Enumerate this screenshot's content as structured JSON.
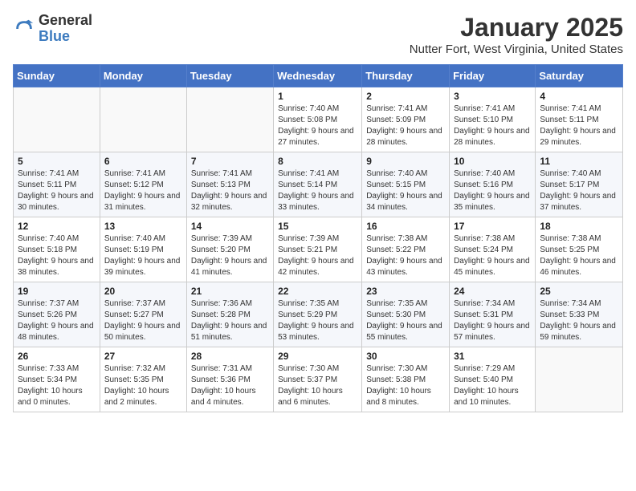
{
  "logo": {
    "general": "General",
    "blue": "Blue"
  },
  "title": "January 2025",
  "subtitle": "Nutter Fort, West Virginia, United States",
  "weekdays": [
    "Sunday",
    "Monday",
    "Tuesday",
    "Wednesday",
    "Thursday",
    "Friday",
    "Saturday"
  ],
  "weeks": [
    [
      {
        "day": "",
        "text": ""
      },
      {
        "day": "",
        "text": ""
      },
      {
        "day": "",
        "text": ""
      },
      {
        "day": "1",
        "text": "Sunrise: 7:40 AM\nSunset: 5:08 PM\nDaylight: 9 hours and 27 minutes."
      },
      {
        "day": "2",
        "text": "Sunrise: 7:41 AM\nSunset: 5:09 PM\nDaylight: 9 hours and 28 minutes."
      },
      {
        "day": "3",
        "text": "Sunrise: 7:41 AM\nSunset: 5:10 PM\nDaylight: 9 hours and 28 minutes."
      },
      {
        "day": "4",
        "text": "Sunrise: 7:41 AM\nSunset: 5:11 PM\nDaylight: 9 hours and 29 minutes."
      }
    ],
    [
      {
        "day": "5",
        "text": "Sunrise: 7:41 AM\nSunset: 5:11 PM\nDaylight: 9 hours and 30 minutes."
      },
      {
        "day": "6",
        "text": "Sunrise: 7:41 AM\nSunset: 5:12 PM\nDaylight: 9 hours and 31 minutes."
      },
      {
        "day": "7",
        "text": "Sunrise: 7:41 AM\nSunset: 5:13 PM\nDaylight: 9 hours and 32 minutes."
      },
      {
        "day": "8",
        "text": "Sunrise: 7:41 AM\nSunset: 5:14 PM\nDaylight: 9 hours and 33 minutes."
      },
      {
        "day": "9",
        "text": "Sunrise: 7:40 AM\nSunset: 5:15 PM\nDaylight: 9 hours and 34 minutes."
      },
      {
        "day": "10",
        "text": "Sunrise: 7:40 AM\nSunset: 5:16 PM\nDaylight: 9 hours and 35 minutes."
      },
      {
        "day": "11",
        "text": "Sunrise: 7:40 AM\nSunset: 5:17 PM\nDaylight: 9 hours and 37 minutes."
      }
    ],
    [
      {
        "day": "12",
        "text": "Sunrise: 7:40 AM\nSunset: 5:18 PM\nDaylight: 9 hours and 38 minutes."
      },
      {
        "day": "13",
        "text": "Sunrise: 7:40 AM\nSunset: 5:19 PM\nDaylight: 9 hours and 39 minutes."
      },
      {
        "day": "14",
        "text": "Sunrise: 7:39 AM\nSunset: 5:20 PM\nDaylight: 9 hours and 41 minutes."
      },
      {
        "day": "15",
        "text": "Sunrise: 7:39 AM\nSunset: 5:21 PM\nDaylight: 9 hours and 42 minutes."
      },
      {
        "day": "16",
        "text": "Sunrise: 7:38 AM\nSunset: 5:22 PM\nDaylight: 9 hours and 43 minutes."
      },
      {
        "day": "17",
        "text": "Sunrise: 7:38 AM\nSunset: 5:24 PM\nDaylight: 9 hours and 45 minutes."
      },
      {
        "day": "18",
        "text": "Sunrise: 7:38 AM\nSunset: 5:25 PM\nDaylight: 9 hours and 46 minutes."
      }
    ],
    [
      {
        "day": "19",
        "text": "Sunrise: 7:37 AM\nSunset: 5:26 PM\nDaylight: 9 hours and 48 minutes."
      },
      {
        "day": "20",
        "text": "Sunrise: 7:37 AM\nSunset: 5:27 PM\nDaylight: 9 hours and 50 minutes."
      },
      {
        "day": "21",
        "text": "Sunrise: 7:36 AM\nSunset: 5:28 PM\nDaylight: 9 hours and 51 minutes."
      },
      {
        "day": "22",
        "text": "Sunrise: 7:35 AM\nSunset: 5:29 PM\nDaylight: 9 hours and 53 minutes."
      },
      {
        "day": "23",
        "text": "Sunrise: 7:35 AM\nSunset: 5:30 PM\nDaylight: 9 hours and 55 minutes."
      },
      {
        "day": "24",
        "text": "Sunrise: 7:34 AM\nSunset: 5:31 PM\nDaylight: 9 hours and 57 minutes."
      },
      {
        "day": "25",
        "text": "Sunrise: 7:34 AM\nSunset: 5:33 PM\nDaylight: 9 hours and 59 minutes."
      }
    ],
    [
      {
        "day": "26",
        "text": "Sunrise: 7:33 AM\nSunset: 5:34 PM\nDaylight: 10 hours and 0 minutes."
      },
      {
        "day": "27",
        "text": "Sunrise: 7:32 AM\nSunset: 5:35 PM\nDaylight: 10 hours and 2 minutes."
      },
      {
        "day": "28",
        "text": "Sunrise: 7:31 AM\nSunset: 5:36 PM\nDaylight: 10 hours and 4 minutes."
      },
      {
        "day": "29",
        "text": "Sunrise: 7:30 AM\nSunset: 5:37 PM\nDaylight: 10 hours and 6 minutes."
      },
      {
        "day": "30",
        "text": "Sunrise: 7:30 AM\nSunset: 5:38 PM\nDaylight: 10 hours and 8 minutes."
      },
      {
        "day": "31",
        "text": "Sunrise: 7:29 AM\nSunset: 5:40 PM\nDaylight: 10 hours and 10 minutes."
      },
      {
        "day": "",
        "text": ""
      }
    ]
  ]
}
